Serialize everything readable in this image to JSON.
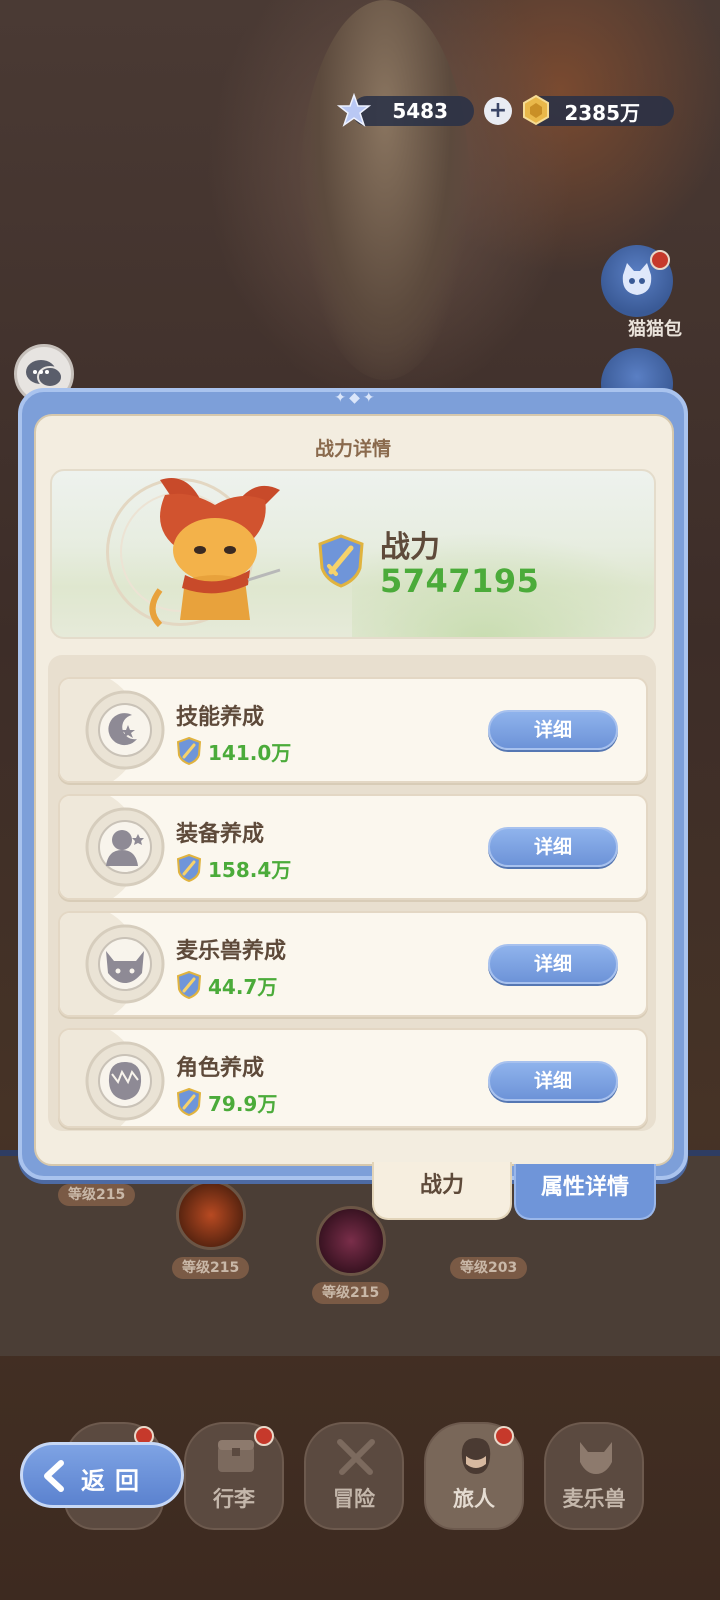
{
  "currency": {
    "gems": "5483",
    "gems_icon": "star-crystal-icon",
    "gold": "2385万",
    "gold_icon": "gold-coin-icon",
    "add_icon": "plus-icon"
  },
  "side": {
    "bag_label": "猫猫包"
  },
  "modal": {
    "title": "战力详情",
    "power_label": "战力",
    "power_value": "5747195",
    "items": [
      {
        "title": "技能养成",
        "value": "141.0万",
        "button": "详细",
        "icon": "moon-star-icon"
      },
      {
        "title": "装备养成",
        "value": "158.4万",
        "button": "详细",
        "icon": "silhouette-icon"
      },
      {
        "title": "麦乐兽养成",
        "value": "44.7万",
        "button": "详细",
        "icon": "cat-face-icon"
      },
      {
        "title": "角色养成",
        "value": "79.9万",
        "button": "详细",
        "icon": "character-head-icon"
      }
    ]
  },
  "tabs": {
    "power": "战力",
    "attributes": "属性详情"
  },
  "background": {
    "levels": [
      "等级215",
      "等级215",
      "等级215",
      "等级203"
    ]
  },
  "nav": {
    "back": "返回",
    "items": [
      "行李",
      "冒险",
      "旅人",
      "麦乐兽"
    ]
  },
  "colors": {
    "accent_blue": "#6f95d9",
    "value_green": "#4bab3a",
    "panel_cream": "#f3ede0",
    "text_brown": "#5e4a3a"
  }
}
